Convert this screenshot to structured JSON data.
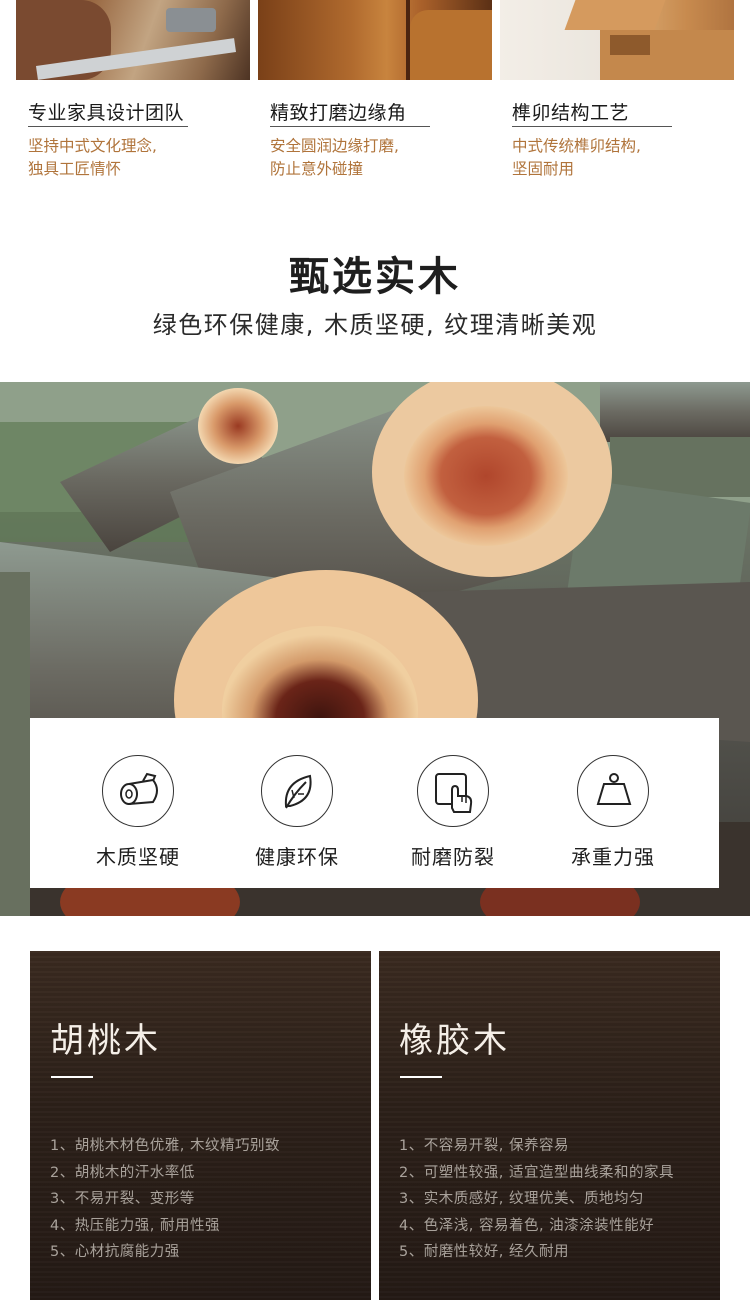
{
  "features": [
    {
      "title": "专业家具设计团队",
      "desc_lines": [
        "坚持中式文化理念,",
        "独具工匠情怀"
      ]
    },
    {
      "title": "精致打磨边缘角",
      "desc_lines": [
        "安全圆润边缘打磨,",
        "防止意外碰撞"
      ]
    },
    {
      "title": "榫卯结构工艺",
      "desc_lines": [
        "中式传统榫卯结构,",
        "坚固耐用"
      ]
    }
  ],
  "section": {
    "title": "甄选实木",
    "subtitle": "绿色环保健康, 木质坚硬, 纹理清晰美观"
  },
  "properties": [
    {
      "label": "木质坚硬",
      "icon": "log-icon"
    },
    {
      "label": "健康环保",
      "icon": "leaf-icon"
    },
    {
      "label": "耐磨防裂",
      "icon": "hand-touch-icon"
    },
    {
      "label": "承重力强",
      "icon": "weight-icon"
    }
  ],
  "woods": [
    {
      "name": "胡桃木",
      "points": [
        "1、胡桃木材色优雅, 木纹精巧别致",
        "2、胡桃木的汗水率低",
        "3、不易开裂、变形等",
        "4、热压能力强, 耐用性强",
        "5、心材抗腐能力强"
      ]
    },
    {
      "name": "橡胶木",
      "points": [
        "1、不容易开裂, 保养容易",
        "2、可塑性较强, 适宜造型曲线柔和的家具",
        "3、实木质感好, 纹理优美、质地均匀",
        "4、色泽浅, 容易着色, 油漆涂装性能好",
        "5、耐磨性较好, 经久耐用"
      ]
    }
  ],
  "colors": {
    "accent_text": "#b0743b",
    "panel_bg": "#2c2019"
  }
}
